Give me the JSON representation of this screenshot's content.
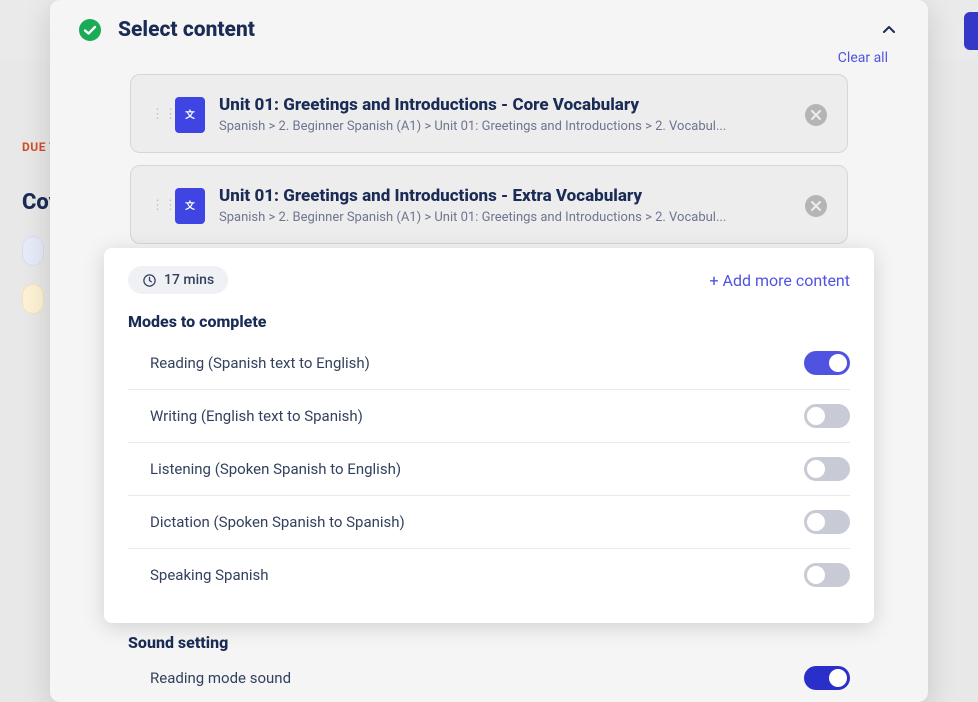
{
  "background": {
    "due_label": "DUE T",
    "cov_label": "Cov"
  },
  "header": {
    "title": "Select content",
    "clear_label": "Clear all"
  },
  "cards": [
    {
      "title": "Unit 01: Greetings and Introductions - Core Vocabulary",
      "path": "Spanish > 2. Beginner Spanish (A1) > Unit 01: Greetings and Introductions > 2. Vocabul..."
    },
    {
      "title": "Unit 01: Greetings and Introductions - Extra Vocabulary",
      "path": "Spanish > 2. Beginner Spanish (A1) > Unit 01: Greetings and Introductions > 2. Vocabul..."
    }
  ],
  "time_pill": "17 mins",
  "add_more_label": "+ Add more content",
  "modes_title": "Modes to complete",
  "modes": [
    {
      "label": "Reading (Spanish text to English)",
      "on": true
    },
    {
      "label": "Writing (English text to Spanish)",
      "on": false
    },
    {
      "label": "Listening (Spoken Spanish to English)",
      "on": false
    },
    {
      "label": "Dictation (Spoken Spanish to Spanish)",
      "on": false
    },
    {
      "label": "Speaking Spanish",
      "on": false
    }
  ],
  "sound": {
    "title": "Sound setting",
    "row_label": "Reading mode sound",
    "on": true
  }
}
